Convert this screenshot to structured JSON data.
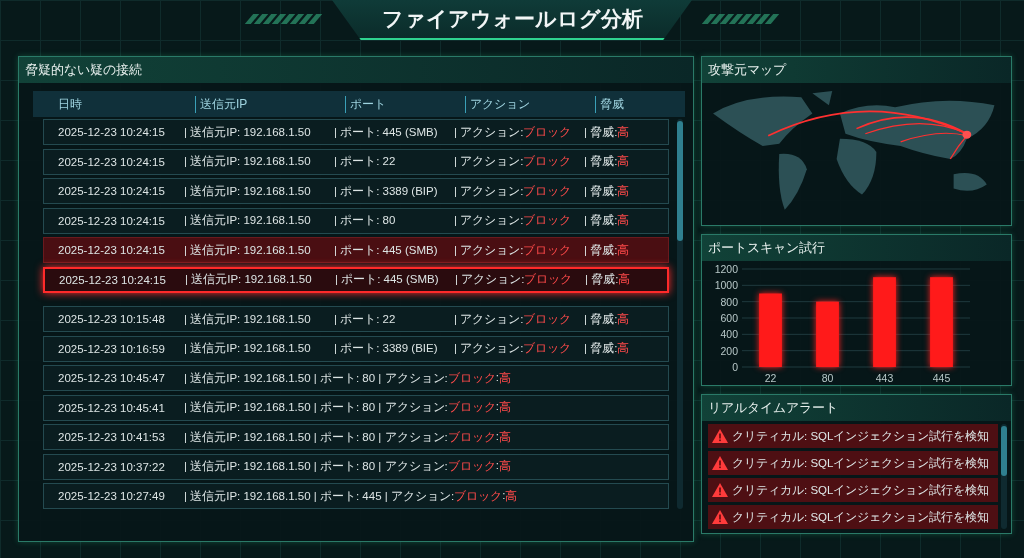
{
  "title": "ファイアウォールログ分析",
  "log_panel": {
    "title": "脅疑的ない疑の接続",
    "columns": [
      "日時",
      "送信元IP",
      "ポート",
      "アクション",
      "脅威"
    ],
    "rows": [
      {
        "kind": "columns",
        "selected": false,
        "flagged": false,
        "cells": [
          [
            {
              "t": "2025-12-23 10:24:15",
              "alert": false
            }
          ],
          [
            {
              "t": "| 送信元IP: 192.168.1.50",
              "alert": false
            }
          ],
          [
            {
              "t": "| ポート: 445 (SMB)",
              "alert": false
            }
          ],
          [
            {
              "t": "| アクション: ",
              "alert": false
            },
            {
              "t": "ブロック",
              "alert": true
            }
          ],
          [
            {
              "t": "| 脅威: ",
              "alert": false
            },
            {
              "t": "高",
              "alert": true
            }
          ]
        ]
      },
      {
        "kind": "columns",
        "selected": false,
        "flagged": false,
        "cells": [
          [
            {
              "t": "2025-12-23 10:24:15",
              "alert": false
            }
          ],
          [
            {
              "t": "| 送信元IP: 192.168.1.50",
              "alert": false
            }
          ],
          [
            {
              "t": "| ポート: 22",
              "alert": false
            }
          ],
          [
            {
              "t": "| アクション: ",
              "alert": false
            },
            {
              "t": "ブロック",
              "alert": true
            }
          ],
          [
            {
              "t": "| 脅威: ",
              "alert": false
            },
            {
              "t": "高",
              "alert": true
            }
          ]
        ]
      },
      {
        "kind": "columns",
        "selected": false,
        "flagged": false,
        "cells": [
          [
            {
              "t": "2025-12-23 10:24:15",
              "alert": false
            }
          ],
          [
            {
              "t": "| 送信元IP: 192.168.1.50",
              "alert": false
            }
          ],
          [
            {
              "t": "| ポート: 3389 (BIP)",
              "alert": false
            }
          ],
          [
            {
              "t": "| アクション: ",
              "alert": false
            },
            {
              "t": "ブロック",
              "alert": true
            }
          ],
          [
            {
              "t": "| 脅威: ",
              "alert": false
            },
            {
              "t": "高",
              "alert": true
            }
          ]
        ]
      },
      {
        "kind": "columns",
        "selected": false,
        "flagged": false,
        "cells": [
          [
            {
              "t": "2025-12-23 10:24:15",
              "alert": false
            }
          ],
          [
            {
              "t": "| 送信元IP: 192.168.1.50",
              "alert": false
            }
          ],
          [
            {
              "t": "| ポート: 80",
              "alert": false
            }
          ],
          [
            {
              "t": "| アクション: ",
              "alert": false
            },
            {
              "t": "ブロック",
              "alert": true
            }
          ],
          [
            {
              "t": "| 脅威: ",
              "alert": false
            },
            {
              "t": "高",
              "alert": true
            }
          ]
        ]
      },
      {
        "kind": "columns",
        "selected": false,
        "flagged": true,
        "cells": [
          [
            {
              "t": "2025-12-23 10:24:15",
              "alert": false
            }
          ],
          [
            {
              "t": "| 送信元IP: 192.168.1.50",
              "alert": false
            }
          ],
          [
            {
              "t": "| ポート: 445 (SMB)",
              "alert": false
            }
          ],
          [
            {
              "t": "| アクション: ",
              "alert": false
            },
            {
              "t": "ブロック",
              "alert": true
            }
          ],
          [
            {
              "t": "| 脅威: ",
              "alert": false
            },
            {
              "t": "高",
              "alert": true
            }
          ]
        ]
      },
      {
        "kind": "columns",
        "selected": true,
        "flagged": false,
        "cells": [
          [
            {
              "t": "2025-12-23 10:24:15",
              "alert": false
            }
          ],
          [
            {
              "t": "| 送信元IP: 192.168.1.50",
              "alert": false
            }
          ],
          [
            {
              "t": "| ポート: 445 (SMB)",
              "alert": false
            }
          ],
          [
            {
              "t": "| アクション: ",
              "alert": false
            },
            {
              "t": "ブロック",
              "alert": true
            }
          ],
          [
            {
              "t": "| 脅威: ",
              "alert": false
            },
            {
              "t": "高",
              "alert": true
            }
          ]
        ]
      },
      {
        "kind": "columns",
        "selected": false,
        "flagged": false,
        "cells": [
          [
            {
              "t": "2025-12-23 10:15:48",
              "alert": false
            }
          ],
          [
            {
              "t": "| 送信元IP: 192.168.1.50",
              "alert": false
            }
          ],
          [
            {
              "t": "| ポート: 22",
              "alert": false
            }
          ],
          [
            {
              "t": "| アクション: ",
              "alert": false
            },
            {
              "t": "ブロック",
              "alert": true
            }
          ],
          [
            {
              "t": "| 脅威: ",
              "alert": false
            },
            {
              "t": "高",
              "alert": true
            }
          ]
        ]
      },
      {
        "kind": "columns",
        "selected": false,
        "flagged": false,
        "cells": [
          [
            {
              "t": "2025-12-23 10:16:59",
              "alert": false
            }
          ],
          [
            {
              "t": "| 送信元IP: 192.168.1.50",
              "alert": false
            }
          ],
          [
            {
              "t": "| ポート: 3389 (BIE)",
              "alert": false
            }
          ],
          [
            {
              "t": "| アクション: ",
              "alert": false
            },
            {
              "t": "ブロック",
              "alert": true
            }
          ],
          [
            {
              "t": "| 脅威: ",
              "alert": false
            },
            {
              "t": "高",
              "alert": true
            }
          ]
        ]
      },
      {
        "kind": "compact",
        "selected": false,
        "flagged": false,
        "cells": [
          [
            {
              "t": "2025-12-23 10:45:47",
              "alert": false
            }
          ],
          [
            {
              "t": "| 送信元IP: 192.168.1.50 | ポート: 80 | アクション: ",
              "alert": false
            },
            {
              "t": "ブロック",
              "alert": true
            },
            {
              "t": ": ",
              "alert": false
            },
            {
              "t": "高",
              "alert": true
            }
          ]
        ]
      },
      {
        "kind": "compact",
        "selected": false,
        "flagged": false,
        "cells": [
          [
            {
              "t": "2025-12-23 10:45:41",
              "alert": false
            }
          ],
          [
            {
              "t": "| 送信元IP: 192.168.1.50 | ポート: 80 | アクション: ",
              "alert": false
            },
            {
              "t": "ブロック",
              "alert": true
            },
            {
              "t": ": ",
              "alert": false
            },
            {
              "t": "高",
              "alert": true
            }
          ]
        ]
      },
      {
        "kind": "compact",
        "selected": false,
        "flagged": false,
        "cells": [
          [
            {
              "t": "2025-12-23 10:41:53",
              "alert": false
            }
          ],
          [
            {
              "t": "| 送信元IP: 192.168.1.50 | ポート: 80 | アクション: ",
              "alert": false
            },
            {
              "t": "ブロック",
              "alert": true
            },
            {
              "t": ": ",
              "alert": false
            },
            {
              "t": "高",
              "alert": true
            }
          ]
        ]
      },
      {
        "kind": "compact",
        "selected": false,
        "flagged": false,
        "cells": [
          [
            {
              "t": "2025-12-23 10:37:22",
              "alert": false
            }
          ],
          [
            {
              "t": "| 送信元IP: 192.168.1.50 | ポート: 80 | アクション: ",
              "alert": false
            },
            {
              "t": "ブロック",
              "alert": true
            },
            {
              "t": ": ",
              "alert": false
            },
            {
              "t": "高",
              "alert": true
            }
          ]
        ]
      },
      {
        "kind": "compact",
        "selected": false,
        "flagged": false,
        "cells": [
          [
            {
              "t": "2025-12-23 10:27:49",
              "alert": false
            }
          ],
          [
            {
              "t": "| 送信元IP: 192.168.1.50 | ポート: 445 | アクション: ",
              "alert": false
            },
            {
              "t": "ブロック",
              "alert": true
            },
            {
              "t": ": ",
              "alert": false
            },
            {
              "t": "高",
              "alert": true
            }
          ]
        ]
      }
    ]
  },
  "map_panel": {
    "title": "攻撃元マップ",
    "kind": "picture"
  },
  "scan_panel": {
    "title": "ポートスキャン試行",
    "chart_data": {
      "type": "bar",
      "categories": [
        "22",
        "80",
        "443",
        "445"
      ],
      "series": [
        {
          "color": "#ff1a1a",
          "values": [
            900,
            800,
            1100,
            1100
          ]
        }
      ],
      "grid": true,
      "ylim": [
        0,
        1200
      ],
      "yticks": [
        0,
        200,
        400,
        600,
        800,
        1000,
        1200
      ]
    }
  },
  "alert_panel": {
    "title": "リアルタイムアラート",
    "alerts": [
      "クリティカル: SQLインジェクション試行を検知",
      "クリティカル: SQLインジェクション試行を検知",
      "クリティカル: SQLインジェクション試行を検知",
      "クリティカル: SQLインジェクション試行を検知"
    ]
  }
}
